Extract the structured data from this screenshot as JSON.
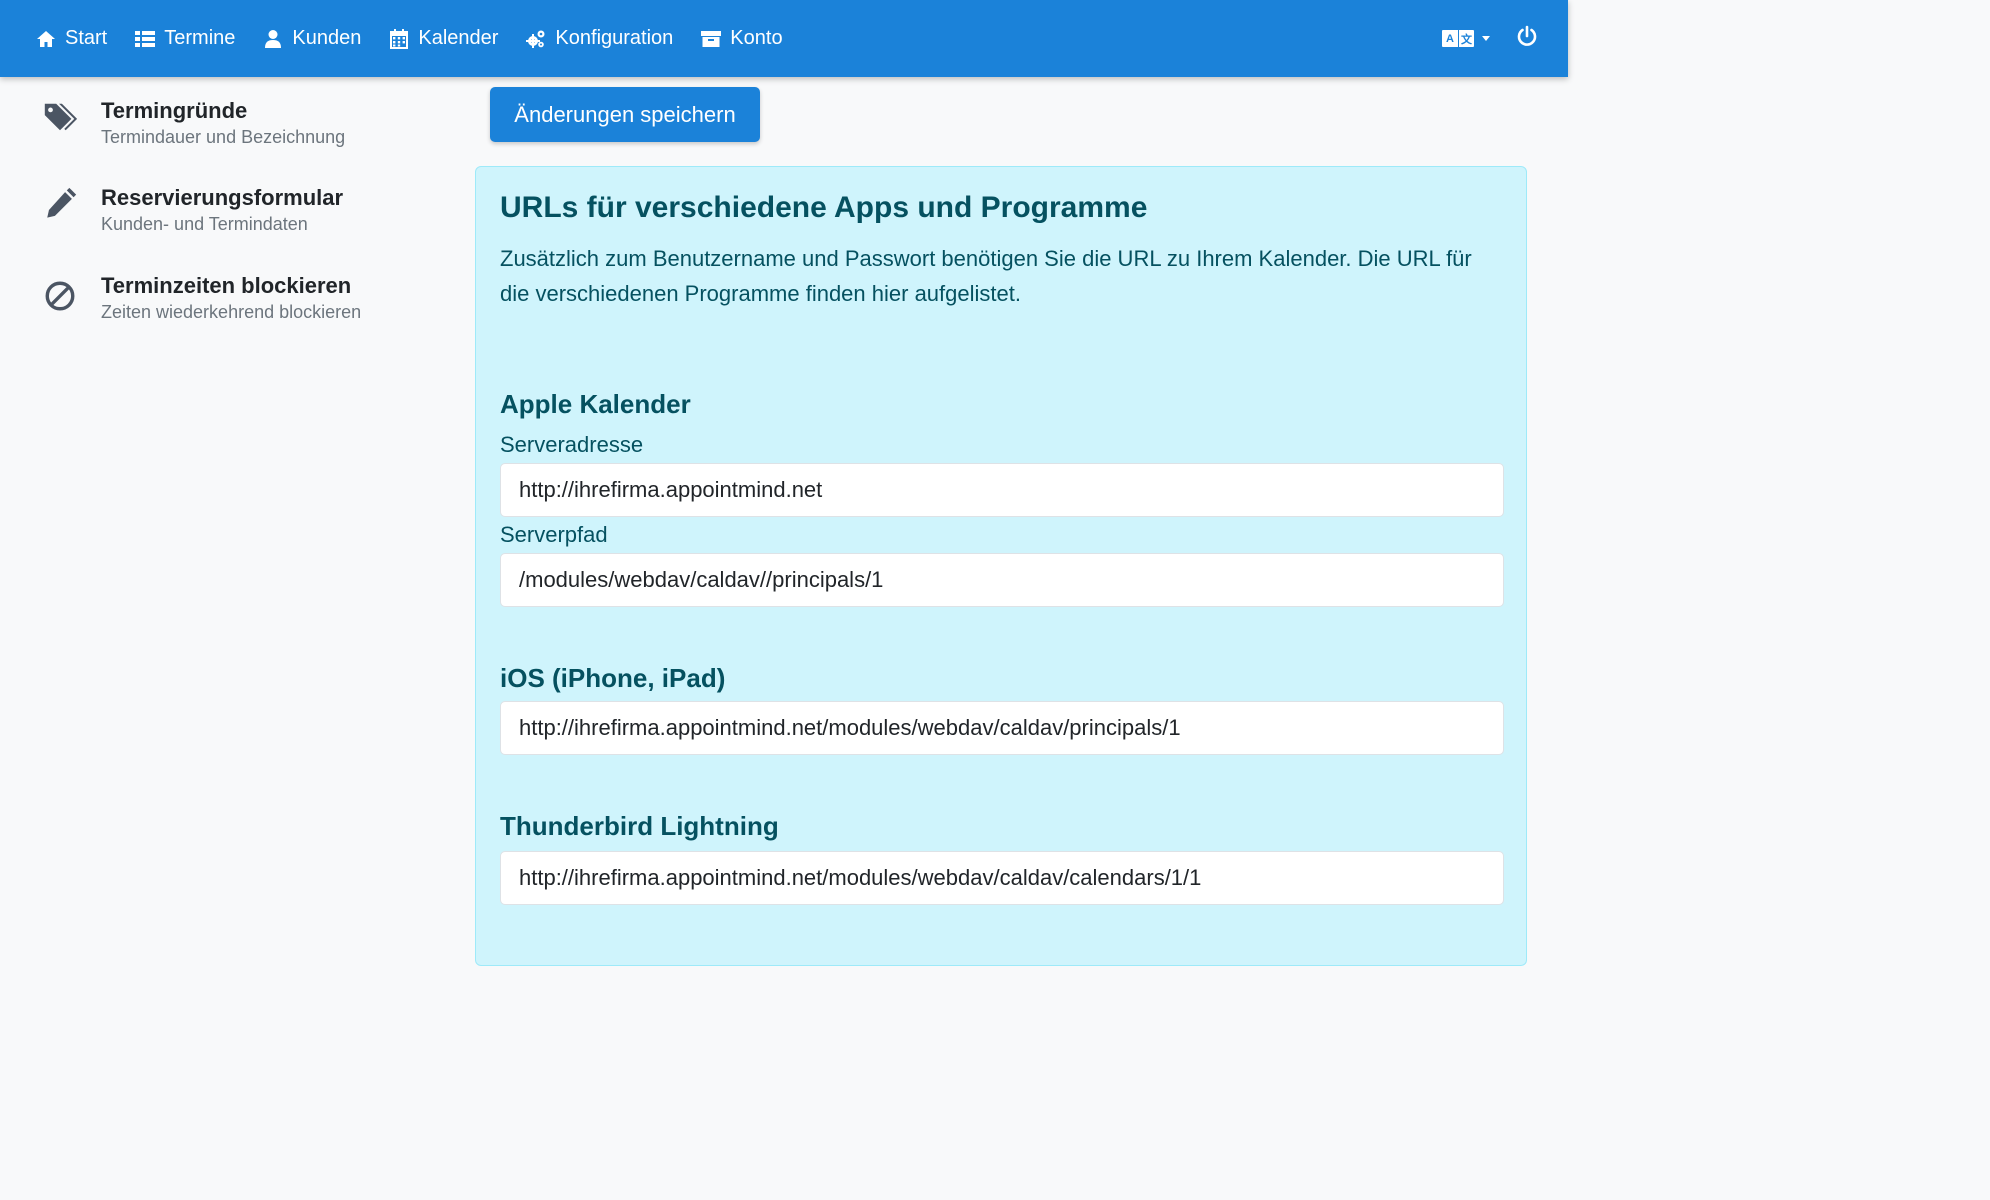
{
  "nav": {
    "items": [
      {
        "label": "Start",
        "icon": "home-icon"
      },
      {
        "label": "Termine",
        "icon": "list-icon"
      },
      {
        "label": "Kunden",
        "icon": "user-icon"
      },
      {
        "label": "Kalender",
        "icon": "calendar-icon"
      },
      {
        "label": "Konfiguration",
        "icon": "cogs-icon"
      },
      {
        "label": "Konto",
        "icon": "archive-icon"
      }
    ],
    "lang": {
      "left": "A",
      "right": "文"
    }
  },
  "sidebar": {
    "items": [
      {
        "title": "Termingründe",
        "subtitle": "Termindauer und Bezeichnung",
        "icon": "tags-icon"
      },
      {
        "title": "Reservierungsformular",
        "subtitle": "Kunden- und Termindaten",
        "icon": "pencil-icon"
      },
      {
        "title": "Terminzeiten blockieren",
        "subtitle": "Zeiten wiederkehrend blockieren",
        "icon": "ban-icon"
      }
    ]
  },
  "actions": {
    "save_label": "Änderungen speichern"
  },
  "panel": {
    "title": "URLs für verschiedene Apps und Programme",
    "description": "Zusätzlich zum Benutzername und Passwort benötigen Sie die URL zu Ihrem Kalender. Die URL für die verschiedenen Programme finden hier aufgelistet.",
    "apple": {
      "title": "Apple Kalender",
      "server_label": "Serveradresse",
      "server_value": "http://ihrefirma.appointmind.net",
      "path_label": "Serverpfad",
      "path_value": "/modules/webdav/caldav//principals/1"
    },
    "ios": {
      "title": "iOS (iPhone, iPad)",
      "value": "http://ihrefirma.appointmind.net/modules/webdav/caldav/principals/1"
    },
    "thunderbird": {
      "title": "Thunderbird Lightning",
      "value": "http://ihrefirma.appointmind.net/modules/webdav/caldav/calendars/1/1"
    }
  }
}
